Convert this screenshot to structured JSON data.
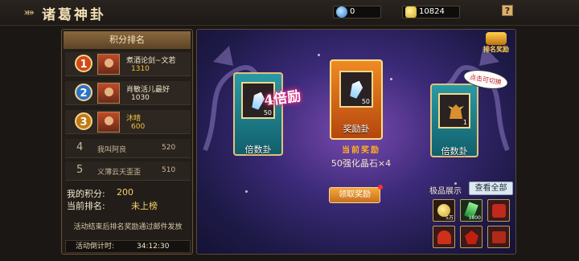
{
  "header": {
    "title": "诸葛神卦",
    "currency_1": "0",
    "currency_2": "10824",
    "help_label": "?"
  },
  "ranking": {
    "title": "积分排名",
    "top": [
      {
        "rank": "1",
        "name": "煮酒论剑~文若",
        "score": "1310"
      },
      {
        "rank": "2",
        "name": "肖敏活儿最好",
        "score": "1030"
      },
      {
        "rank": "3",
        "name": "沐晴",
        "score": "600"
      }
    ],
    "others": [
      {
        "rank": "4",
        "name": "我叫阿良",
        "score": "520"
      },
      {
        "rank": "5",
        "name": "义薄云天歪歪",
        "score": "510"
      }
    ],
    "my_score_label": "我的积分:",
    "my_score": "200",
    "my_rank_label": "当前排名:",
    "my_rank": "未上榜",
    "notice": "活动结束后排名奖励通过邮件发放",
    "countdown_label": "活动倒计时:",
    "countdown": "34:12:30"
  },
  "stage": {
    "rank_reward_label": "排名奖励",
    "tap_hint": "点击可切换",
    "multiplier_badge": "4倍励",
    "cards": [
      {
        "label": "倍数卦",
        "count": "50",
        "color": "teal"
      },
      {
        "label": "奖励卦",
        "count": "50",
        "color": "orange"
      },
      {
        "label": "倍数卦",
        "count": "1",
        "color": "teal"
      }
    ],
    "current_reward_title": "当前奖励",
    "current_reward": "50强化晶石×4",
    "claim_button": "领取奖励",
    "showcase_label": "极品展示",
    "view_all_button": "查看全部",
    "showcase_counts": [
      "5万",
      "1000"
    ]
  },
  "colors": {
    "accent_gold": "#f6d26a",
    "teal_card": "#2a9aa6",
    "orange_card": "#f08a24"
  }
}
